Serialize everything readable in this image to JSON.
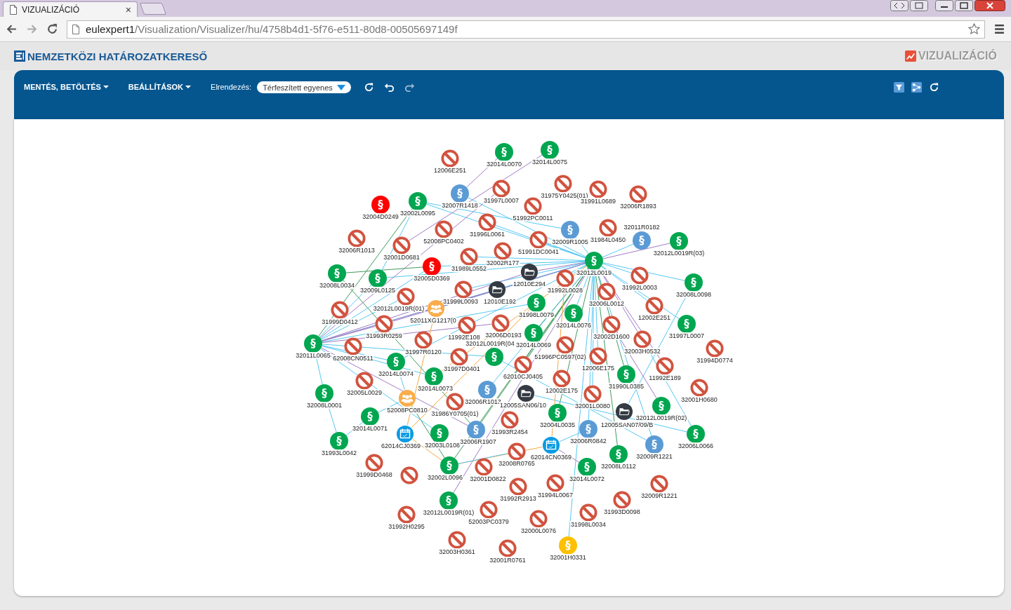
{
  "browser": {
    "tab": {
      "title": "VIZUALIZÁCIÓ",
      "close": "×"
    },
    "address": {
      "host": "eulexpert1",
      "path": "/Visualization/Visualizer/hu/4758b4d1-5f76-e511-80d8-00505697149f"
    }
  },
  "app": {
    "brand": "NEMZETKÖZI HATÁROZATKERESŐ",
    "section": "VIZUALIZÁCIÓ"
  },
  "toolbar": {
    "menus": [
      "MENTÉS, BETÖLTÉS",
      "BEÁLLÍTÁSOK"
    ],
    "layout_label": "Elrendezés:",
    "layout_value": "Térfeszített egyenes"
  },
  "graph": {
    "nodes": [
      {
        "kind": "repealed",
        "label": "12006E251"
      },
      {
        "kind": "act",
        "color": "#00a650",
        "symbol": "§",
        "label": "32014L0070"
      },
      {
        "kind": "act",
        "color": "#00a650",
        "symbol": "§",
        "label": "32014L0075"
      },
      {
        "kind": "act",
        "color": "#00a650",
        "symbol": "§",
        "label": "32002L0095"
      },
      {
        "kind": "act",
        "color": "#5b9bd5",
        "symbol": "§",
        "label": "32007R1418"
      },
      {
        "kind": "repealed",
        "label": "31997L0007"
      },
      {
        "kind": "repealed",
        "label": "31975Y0425(01)"
      },
      {
        "kind": "repealed",
        "label": "31991L0689"
      },
      {
        "kind": "repealed",
        "label": "32006R1893"
      },
      {
        "kind": "act",
        "color": "#ff0000",
        "symbol": "§",
        "label": "32004D0249"
      },
      {
        "kind": "repealed",
        "label": "51992PC0011"
      },
      {
        "kind": "repealed",
        "label": "52008PC0402"
      },
      {
        "kind": "repealed",
        "label": "31996L0061"
      },
      {
        "kind": "act",
        "color": "#5b9bd5",
        "symbol": "§",
        "label": "32009R1005"
      },
      {
        "kind": "repealed",
        "label": "31984L0450"
      },
      {
        "kind": "repealed",
        "label": "32006R1013"
      },
      {
        "kind": "repealed",
        "label": "32001D0681"
      },
      {
        "kind": "repealed",
        "label": "51991DC0041"
      },
      {
        "kind": "act",
        "color": "#5b9bd5",
        "symbol": "§",
        "label": "32011R0182"
      },
      {
        "kind": "act",
        "color": "#00a650",
        "symbol": "§",
        "label": "32012L0019R(03)"
      },
      {
        "kind": "act",
        "color": "#ff0000",
        "symbol": "§",
        "label": "32005D0369"
      },
      {
        "kind": "repealed",
        "label": "31989L0552"
      },
      {
        "kind": "repealed",
        "label": "32002R177"
      },
      {
        "kind": "act",
        "color": "#00a650",
        "symbol": "§",
        "label": "32012L0019"
      },
      {
        "kind": "act",
        "color": "#00a650",
        "symbol": "§",
        "label": "32008L0034"
      },
      {
        "kind": "act",
        "color": "#00a650",
        "symbol": "§",
        "label": "32009L0125"
      },
      {
        "kind": "folder",
        "label": "12010E294"
      },
      {
        "kind": "repealed",
        "label": "31992L0028"
      },
      {
        "kind": "repealed",
        "label": "31992L0003"
      },
      {
        "kind": "repealed",
        "label": "31999L0093"
      },
      {
        "kind": "folder",
        "label": "12010E192"
      },
      {
        "kind": "act",
        "color": "#00a650",
        "symbol": "§",
        "label": "32008L0098"
      },
      {
        "kind": "repealed",
        "label": "32012L0019R(01)"
      },
      {
        "kind": "repealed",
        "label": "32006L0012"
      },
      {
        "kind": "repealed",
        "label": "31999D0412"
      },
      {
        "kind": "group",
        "label": "52011XG1217(0"
      },
      {
        "kind": "act",
        "color": "#00a650",
        "symbol": "§",
        "label": "31998L0079"
      },
      {
        "kind": "act",
        "color": "#00a650",
        "symbol": "§",
        "label": "32014L0076"
      },
      {
        "kind": "repealed",
        "label": "12002E251"
      },
      {
        "kind": "repealed",
        "label": "31993R0259"
      },
      {
        "kind": "repealed",
        "label": "11992E108"
      },
      {
        "kind": "repealed",
        "label": "32006D0193"
      },
      {
        "kind": "repealed",
        "label": "32002D1600"
      },
      {
        "kind": "act",
        "color": "#00a650",
        "symbol": "§",
        "label": "31997L0007"
      },
      {
        "kind": "repealed",
        "label": "31997R0120"
      },
      {
        "kind": "act",
        "color": "#00a650",
        "symbol": "§",
        "label": "32014L0069"
      },
      {
        "kind": "repealed",
        "label": "32003H0532"
      },
      {
        "kind": "act",
        "color": "#00a650",
        "symbol": "§",
        "label": "32011L0065"
      },
      {
        "kind": "repealed",
        "label": "62008CN0511"
      },
      {
        "kind": "act",
        "color": "#00a650",
        "symbol": "§",
        "label": "32014L0074"
      },
      {
        "kind": "repealed",
        "label": "31997D0401"
      },
      {
        "kind": "act",
        "color": "#00a650",
        "symbol": "§",
        "label": "32012L0019R(04"
      },
      {
        "kind": "repealed",
        "label": "62010CJ0405"
      },
      {
        "kind": "repealed",
        "label": "51996PC0597(02)"
      },
      {
        "kind": "repealed",
        "label": "12006E175"
      },
      {
        "kind": "repealed",
        "label": "31994D0774"
      },
      {
        "kind": "repealed",
        "label": "32005L0029"
      },
      {
        "kind": "act",
        "color": "#00a650",
        "symbol": "§",
        "label": "32014L0073"
      },
      {
        "kind": "repealed",
        "label": "12002E175"
      },
      {
        "kind": "act",
        "color": "#00a650",
        "symbol": "§",
        "label": "31990L0385"
      },
      {
        "kind": "repealed",
        "label": "11992E189"
      },
      {
        "kind": "act",
        "color": "#00a650",
        "symbol": "§",
        "label": "32008L0001"
      },
      {
        "kind": "group",
        "label": "52008PC0810"
      },
      {
        "kind": "repealed",
        "label": "31986Y0705(01)"
      },
      {
        "kind": "act",
        "color": "#5b9bd5",
        "symbol": "§",
        "label": "32006R1013"
      },
      {
        "kind": "folder",
        "label": "12005SAN06/10"
      },
      {
        "kind": "repealed",
        "label": "32001L0080"
      },
      {
        "kind": "act",
        "color": "#00a650",
        "symbol": "§",
        "label": "32012L0019R(02)"
      },
      {
        "kind": "repealed",
        "label": "32001H0680"
      },
      {
        "kind": "act",
        "color": "#00a650",
        "symbol": "§",
        "label": "32014L0071"
      },
      {
        "kind": "repealed",
        "label": "31993R2454"
      },
      {
        "kind": "act",
        "color": "#00a650",
        "symbol": "§",
        "label": "32004L0035"
      },
      {
        "kind": "folder",
        "label": "12005SAN07/09/B"
      },
      {
        "kind": "act",
        "color": "#00a650",
        "symbol": "§",
        "label": "31993L0042"
      },
      {
        "kind": "calendar",
        "label": "62014CJ0369"
      },
      {
        "kind": "act",
        "color": "#00a650",
        "symbol": "§",
        "label": "32003L0108"
      },
      {
        "kind": "act",
        "color": "#5b9bd5",
        "symbol": "§",
        "label": "32006R1907"
      },
      {
        "kind": "calendar",
        "label": "62014CN0369"
      },
      {
        "kind": "act",
        "color": "#5b9bd5",
        "symbol": "§",
        "label": "32006R0842"
      },
      {
        "kind": "act",
        "color": "#5b9bd5",
        "symbol": "§",
        "label": "32009R1221"
      },
      {
        "kind": "act",
        "color": "#00a650",
        "symbol": "§",
        "label": "32006L0066"
      },
      {
        "kind": "repealed",
        "label": "31999D0468"
      },
      {
        "kind": "act",
        "color": "#00a650",
        "symbol": "§",
        "label": "32002L0096"
      },
      {
        "kind": "repealed",
        "label": "32001D0822"
      },
      {
        "kind": "repealed",
        "label": "32008R0765"
      },
      {
        "kind": "act",
        "color": "#00a650",
        "symbol": "§",
        "label": "32014L0072"
      },
      {
        "kind": "act",
        "color": "#00a650",
        "symbol": "§",
        "label": "32008L0112"
      },
      {
        "kind": "repealed"
      },
      {
        "kind": "repealed",
        "label": "31992R2913"
      },
      {
        "kind": "repealed",
        "label": "31994L0067"
      },
      {
        "kind": "repealed",
        "label": "32009R1221"
      },
      {
        "kind": "repealed",
        "label": "31992H0295"
      },
      {
        "kind": "act",
        "color": "#00a650",
        "symbol": "§",
        "label": "32012L0019R(01)"
      },
      {
        "kind": "repealed",
        "label": "52003PC0379"
      },
      {
        "kind": "repealed",
        "label": "31998L0034"
      },
      {
        "kind": "repealed",
        "label": "31993D0098"
      },
      {
        "kind": "repealed",
        "label": "32000L0076"
      },
      {
        "kind": "repealed",
        "label": "32003H0361"
      },
      {
        "kind": "repealed",
        "label": "32001R0761"
      },
      {
        "kind": "act",
        "color": "#ffc000",
        "symbol": "§",
        "label": "32001H0331"
      }
    ]
  }
}
